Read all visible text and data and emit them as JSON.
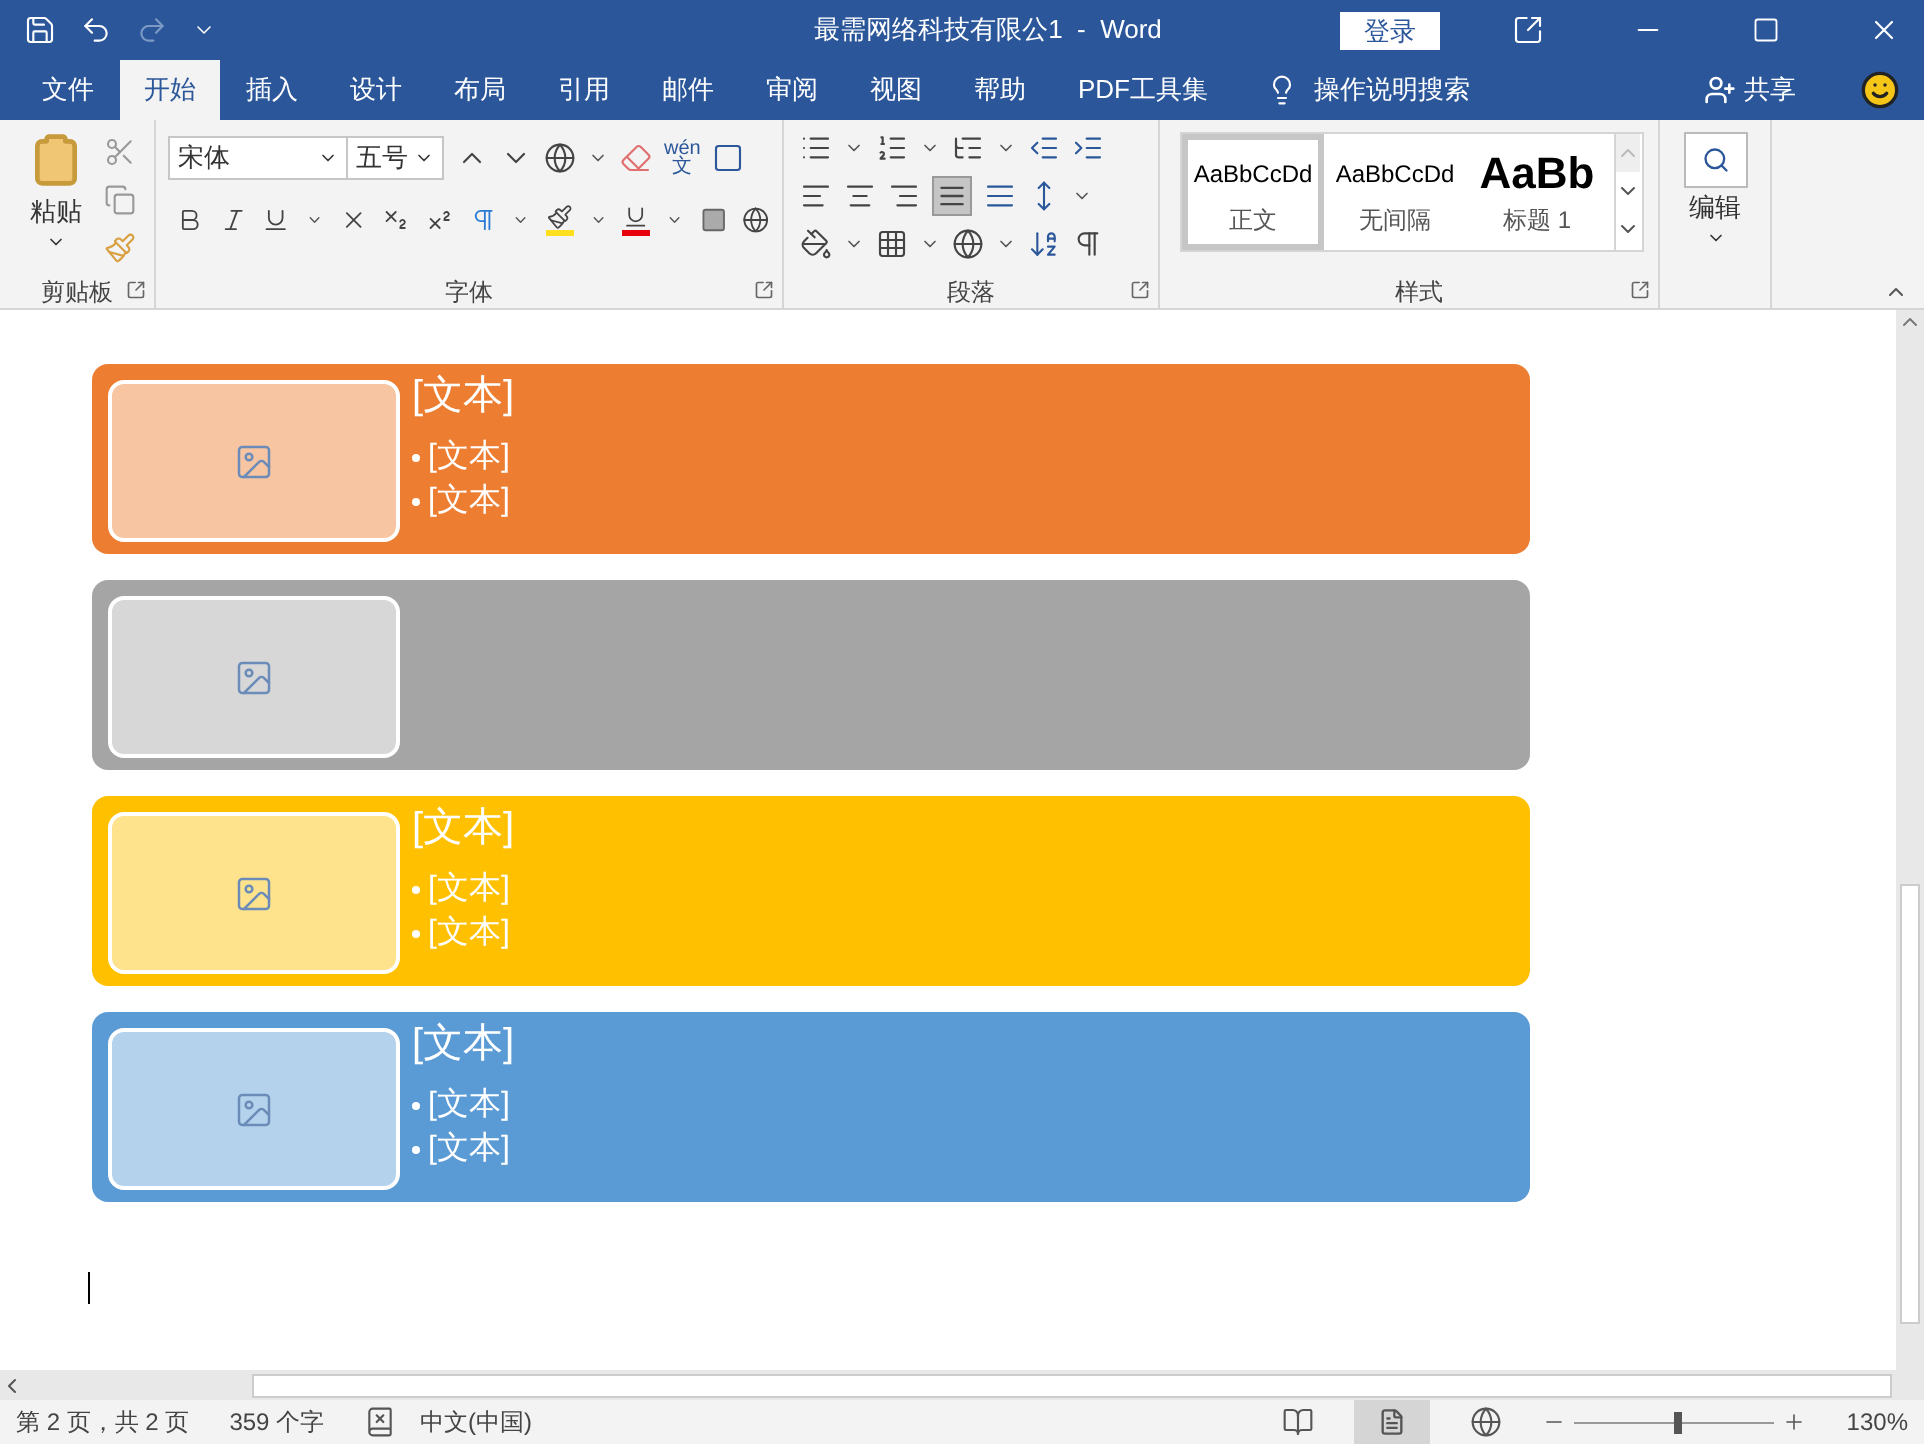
{
  "window": {
    "title": "最需网络科技有限公1  -  Word",
    "login": "登录"
  },
  "tabs": [
    {
      "label": "文件",
      "selected": false
    },
    {
      "label": "开始",
      "selected": true
    },
    {
      "label": "插入",
      "selected": false
    },
    {
      "label": "设计",
      "selected": false
    },
    {
      "label": "布局",
      "selected": false
    },
    {
      "label": "引用",
      "selected": false
    },
    {
      "label": "邮件",
      "selected": false
    },
    {
      "label": "审阅",
      "selected": false
    },
    {
      "label": "视图",
      "selected": false
    },
    {
      "label": "帮助",
      "selected": false
    },
    {
      "label": "PDF工具集",
      "selected": false
    }
  ],
  "tell_me": "操作说明搜索",
  "share": "共享",
  "ribbon": {
    "clipboard": {
      "paste": "粘贴",
      "label": "剪贴板"
    },
    "font": {
      "name": "宋体",
      "size": "五号",
      "label": "字体",
      "pinyin": "wén",
      "pinyin_char": "文"
    },
    "paragraph": {
      "label": "段落"
    },
    "styles": {
      "label": "样式",
      "items": [
        {
          "preview": "AaBbCcDd",
          "name": "正文",
          "selected": true,
          "kind": "normal"
        },
        {
          "preview": "AaBbCcDd",
          "name": "无间隔",
          "selected": false,
          "kind": "normal"
        },
        {
          "preview": "AaBb",
          "name": "标题 1",
          "selected": false,
          "kind": "heading"
        }
      ]
    },
    "editing": {
      "label": "编辑"
    }
  },
  "cards": [
    {
      "color": "#ed7d31",
      "title": "[文本]",
      "bullets": [
        "[文本]",
        "[文本]"
      ]
    },
    {
      "color": "#a5a5a5"
    },
    {
      "color": "#ffc000",
      "title": "[文本]",
      "bullets": [
        "[文本]",
        "[文本]"
      ]
    },
    {
      "color": "#5b9bd5",
      "title": "[文本]",
      "bullets": [
        "[文本]",
        "[文本]"
      ]
    }
  ],
  "status_bar": {
    "page": "第 2 页，共 2 页",
    "words": "359 个字",
    "language": "中文(中国)",
    "zoom": "130%",
    "level": 0.52
  }
}
